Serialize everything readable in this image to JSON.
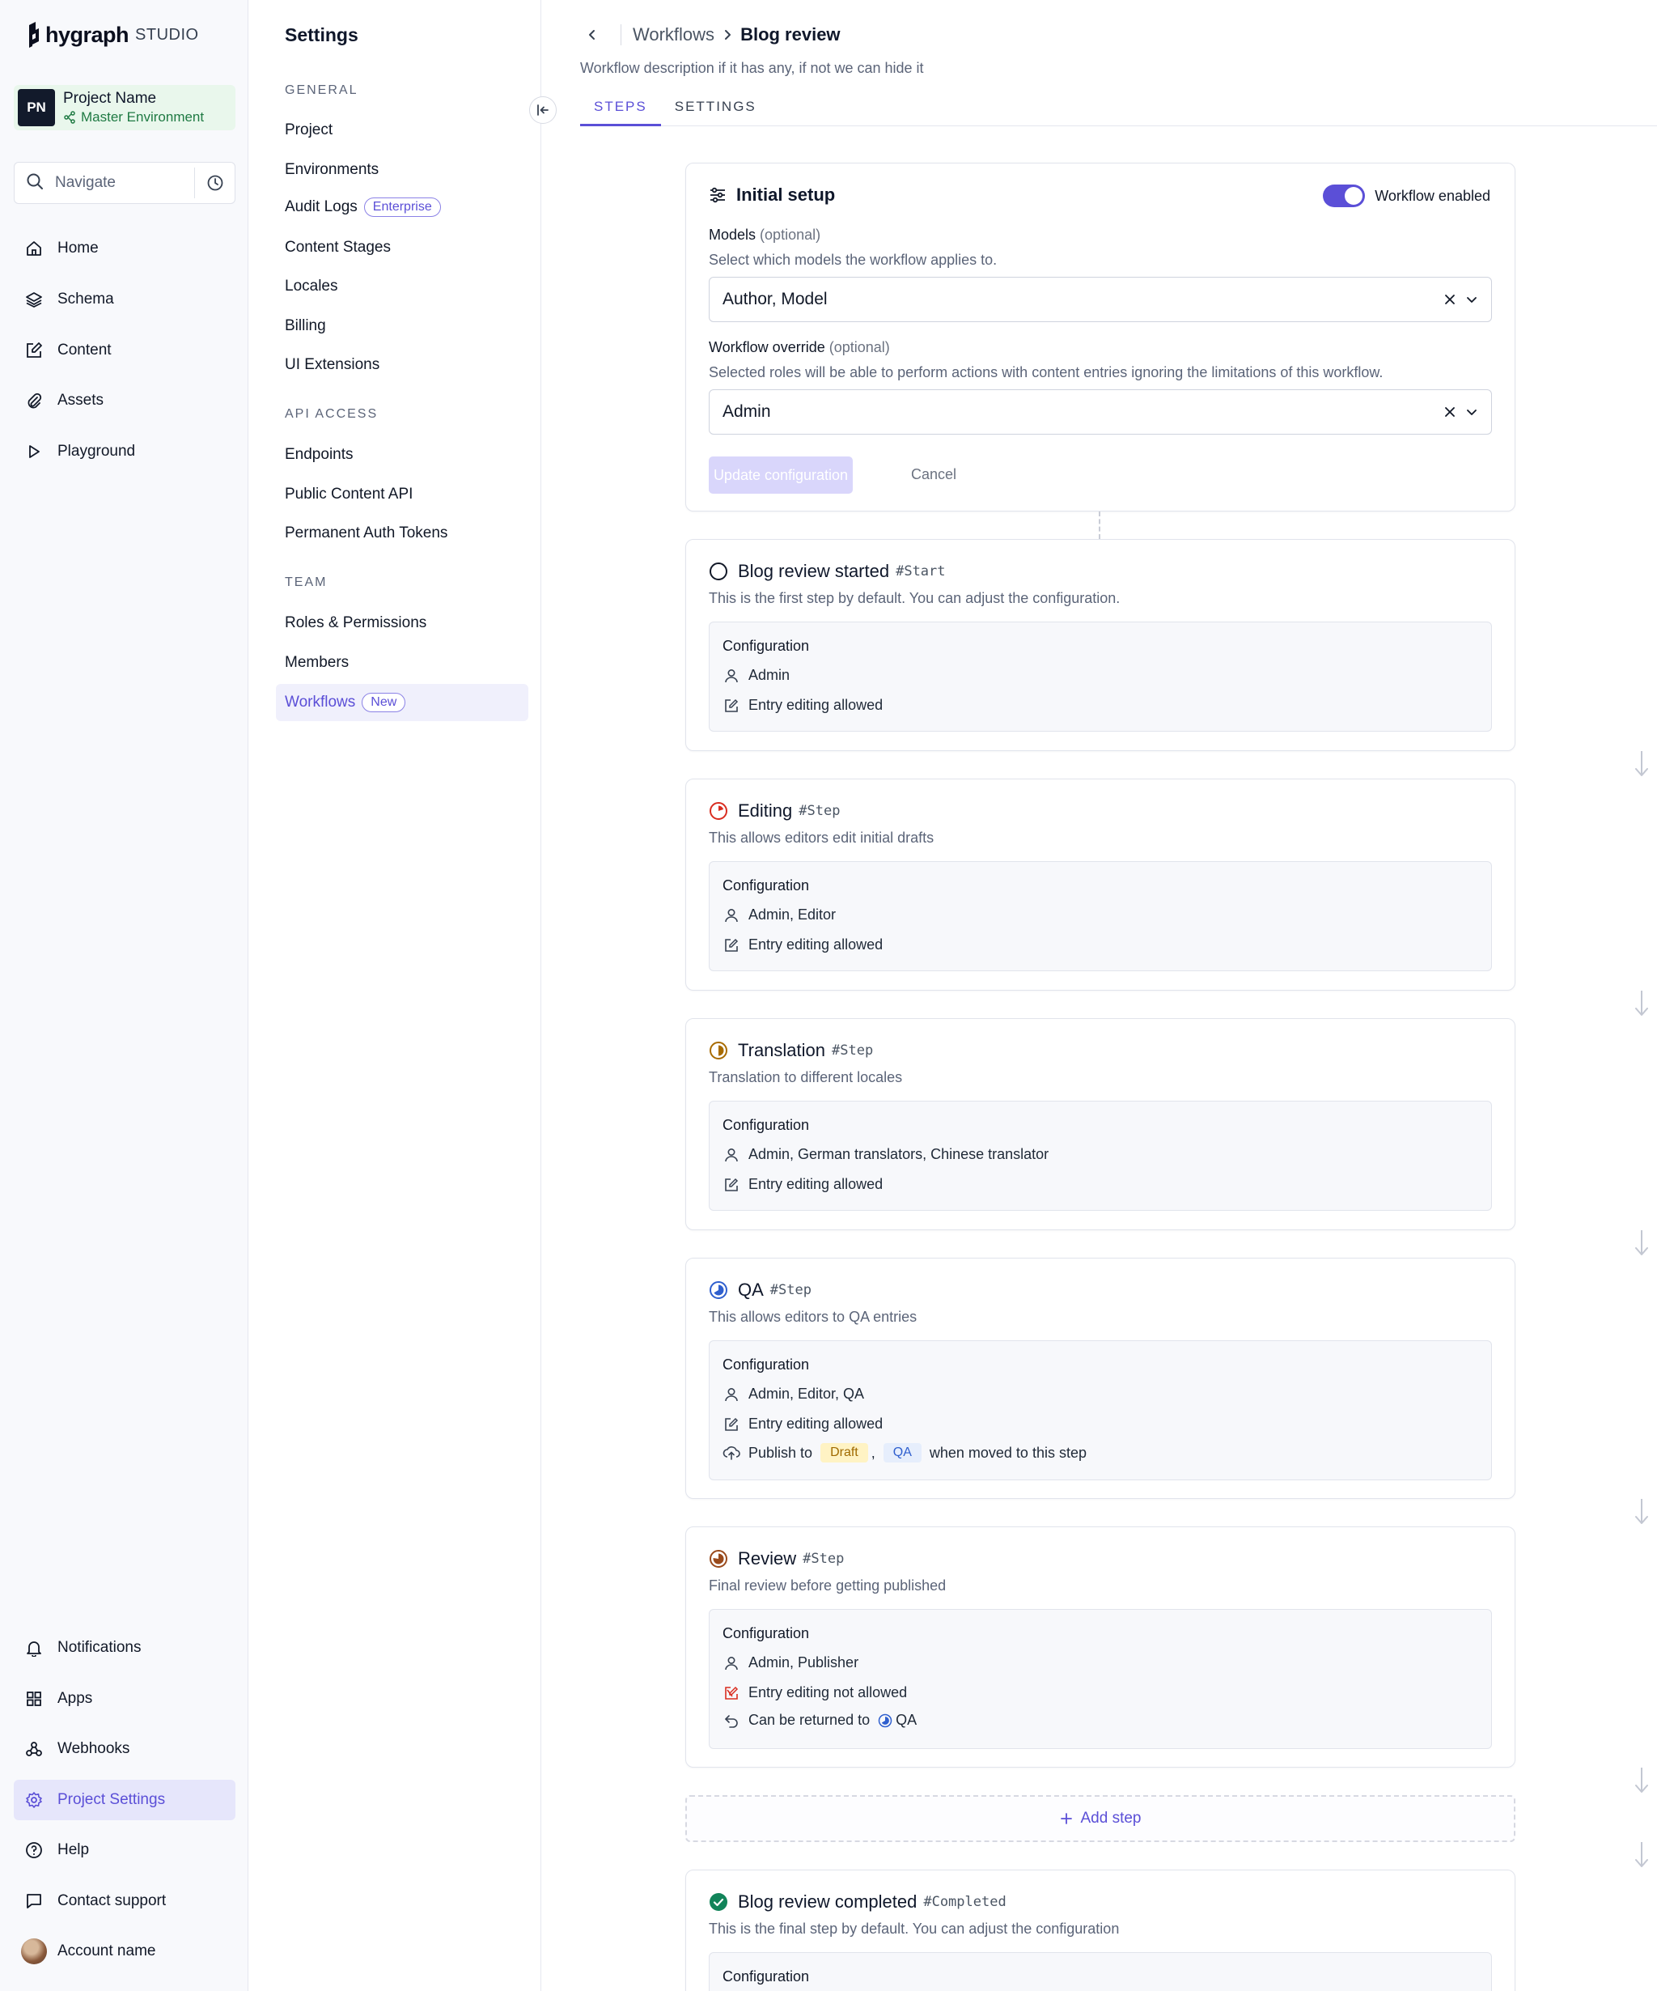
{
  "nav": {
    "brand": "hygraph",
    "studio": "STUDIO",
    "project": {
      "initials": "PN",
      "name": "Project Name",
      "environment": "Master Environment"
    },
    "search_placeholder": "Navigate",
    "top_items": [
      {
        "label": "Home",
        "icon": "home-icon"
      },
      {
        "label": "Schema",
        "icon": "layers-icon"
      },
      {
        "label": "Content",
        "icon": "edit-icon"
      },
      {
        "label": "Assets",
        "icon": "paperclip-icon"
      },
      {
        "label": "Playground",
        "icon": "play-icon"
      }
    ],
    "bottom_items": [
      {
        "label": "Notifications",
        "icon": "bell-icon"
      },
      {
        "label": "Apps",
        "icon": "apps-icon"
      },
      {
        "label": "Webhooks",
        "icon": "webhooks-icon"
      },
      {
        "label": "Project Settings",
        "icon": "gear-icon",
        "active": true
      },
      {
        "label": "Help",
        "icon": "help-icon"
      },
      {
        "label": "Contact support",
        "icon": "chat-icon"
      },
      {
        "label": "Account name",
        "icon": "avatar"
      }
    ]
  },
  "settings": {
    "title": "Settings",
    "sections": [
      {
        "title": "GENERAL",
        "items": [
          "Project",
          "Environments",
          "Audit Logs",
          "Content Stages",
          "Locales",
          "Billing",
          "UI Extensions"
        ]
      },
      {
        "title": "API ACCESS",
        "items": [
          "Endpoints",
          "Public Content API",
          "Permanent Auth Tokens"
        ]
      },
      {
        "title": "TEAM",
        "items": [
          "Roles & Permissions",
          "Members",
          "Workflows"
        ]
      }
    ],
    "badges": {
      "audit_logs": "Enterprise",
      "workflows": "New"
    }
  },
  "main": {
    "breadcrumb": {
      "parent": "Workflows",
      "current": "Blog review"
    },
    "description": "Workflow description if it has any, if not we can hide it",
    "tabs": [
      "STEPS",
      "SETTINGS"
    ],
    "active_tab": "STEPS",
    "initial_setup": {
      "title": "Initial setup",
      "toggle_label": "Workflow enabled",
      "toggle_on": true,
      "models_label": "Models",
      "models_optional": "(optional)",
      "models_help": "Select which models the workflow applies to.",
      "models_value": "Author, Model",
      "override_label": "Workflow override",
      "override_optional": "(optional)",
      "override_help": "Selected roles will be able to perform actions with content entries ignoring the limitations of this workflow.",
      "override_value": "Admin",
      "update_button": "Update configuration",
      "cancel_button": "Cancel"
    },
    "config_label": "Configuration",
    "steps": [
      {
        "name": "Blog review started",
        "tag": "#Start",
        "description": "This is the first step by default. You can adjust the configuration.",
        "status_icon": "empty-circle-icon",
        "roles": "Admin",
        "editing": "Entry editing allowed"
      },
      {
        "name": "Editing",
        "tag": "#Step",
        "description": "This allows editors edit initial drafts",
        "status_icon": "progress-red-icon",
        "color": "#d92d20",
        "roles": "Admin, Editor",
        "editing": "Entry editing allowed"
      },
      {
        "name": "Translation",
        "tag": "#Step",
        "description": "Translation to different locales",
        "status_icon": "progress-amber-icon",
        "color": "#a86b00",
        "roles": "Admin, German translators, Chinese translator",
        "editing": "Entry editing allowed"
      },
      {
        "name": "QA",
        "tag": "#Step",
        "description": "This allows editors to QA entries",
        "status_icon": "progress-blue-icon",
        "color": "#2f5fce",
        "roles": "Admin, Editor, QA",
        "editing": "Entry editing allowed",
        "publish": {
          "prefix": "Publish to",
          "stages": [
            "Draft",
            "QA"
          ],
          "separator": ",",
          "suffix": "when moved to this step"
        }
      },
      {
        "name": "Review",
        "tag": "#Step",
        "description": "Final review before getting published",
        "status_icon": "progress-brown-icon",
        "color": "#9a4a1c",
        "roles": "Admin, Publisher",
        "editing": "Entry editing not allowed",
        "return": {
          "prefix": "Can be returned to",
          "target": "QA"
        }
      }
    ],
    "add_step": "Add step",
    "completed": {
      "name": "Blog review completed",
      "tag": "#Completed",
      "description": "This is the final step by default. You can adjust the configuration",
      "status_icon": "check-circle-icon"
    },
    "colors": {
      "accent": "#5b4fd7",
      "success": "#12845a"
    }
  }
}
